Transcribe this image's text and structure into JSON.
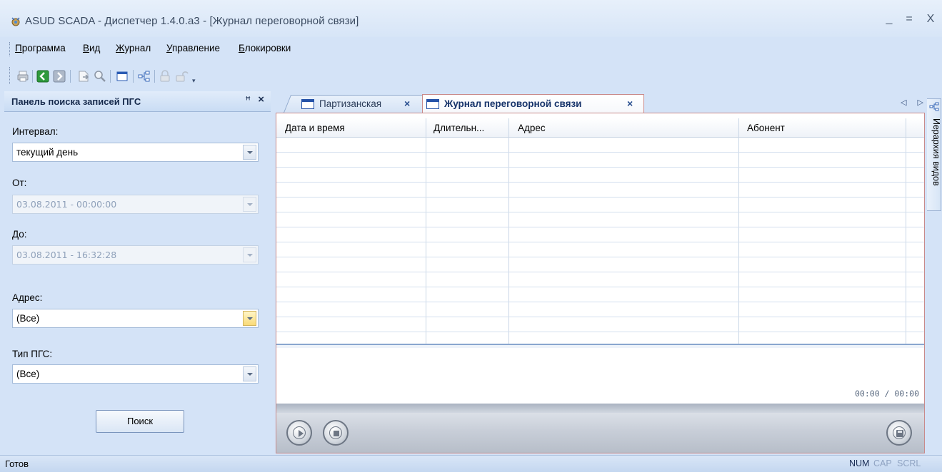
{
  "window": {
    "title": "ASUD SCADA - Диспетчер 1.4.0.a3 - [Журнал переговорной связи]",
    "minimize": "_",
    "maximize": "=",
    "close": "X"
  },
  "menu": [
    {
      "label_u": "П",
      "label_rest": "рограмма"
    },
    {
      "label_u": "В",
      "label_rest": "ид"
    },
    {
      "label_u": "Ж",
      "label_rest": "урнал"
    },
    {
      "label_u": "У",
      "label_rest": "правление"
    },
    {
      "label_u": "Б",
      "label_rest": "локировки"
    }
  ],
  "toolbar_icons": [
    "printer-icon",
    "back-icon",
    "forward-icon",
    "export-icon",
    "zoom-icon",
    "window-icon",
    "hierarchy-icon",
    "lock-icon",
    "unlock-icon"
  ],
  "search_panel": {
    "title": "Панель поиска записей ПГС",
    "pin": "ꟸ",
    "close": "×",
    "interval_label": "Интервал:",
    "interval_value": "текущий день",
    "from_label": "От:",
    "from_value": "03.08.2011 - 00:00:00",
    "to_label": "До:",
    "to_value": "03.08.2011 - 16:32:28",
    "address_label": "Адрес:",
    "address_value": "(Все)",
    "type_label": "Тип ПГС:",
    "type_value": "(Все)",
    "search_button": "Поиск"
  },
  "tabs": [
    {
      "label": "Партизанская",
      "close": "×",
      "active": false
    },
    {
      "label": "Журнал переговорной связи",
      "close": "×",
      "active": true
    }
  ],
  "tab_nav": "◁ ▷",
  "grid": {
    "columns": [
      "Дата и время",
      "Длительн...",
      "Адрес",
      "Абонент"
    ],
    "rows": []
  },
  "player": {
    "time": "00:00 / 00:00"
  },
  "side_tab": "Иерархия видов",
  "status": {
    "text": "Готов",
    "num": "NUM",
    "cap": "CAP",
    "scrl": "SCRL",
    "active_color": "#1a2d55",
    "inactive_color": "#8fa3c2"
  }
}
